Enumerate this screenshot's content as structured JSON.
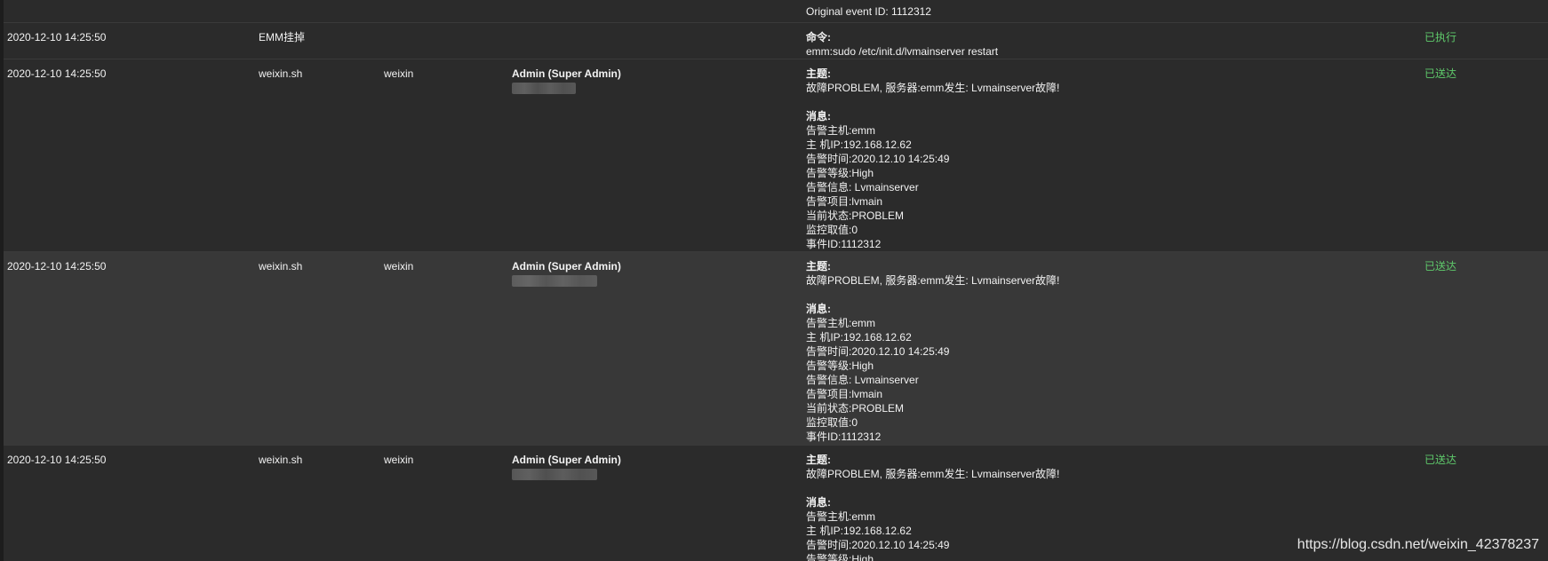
{
  "row0": {
    "msg_line": "Original event ID: 1112312"
  },
  "row1": {
    "time": "2020-12-10 14:25:50",
    "type": "EMM挂掉",
    "msg_label": "命令:",
    "msg_line": "emm:sudo /etc/init.d/lvmainserver restart",
    "status": "已执行"
  },
  "notify_rows": [
    {
      "time": "2020-12-10 14:25:50",
      "type": "weixin.sh",
      "method": "weixin",
      "recipient": "Admin (Super Admin)",
      "subject_label": "主题:",
      "subject": "故障PROBLEM, 服务器:emm发生: Lvmainserver故障!",
      "message_label": "消息:",
      "lines": [
        "告警主机:emm",
        "主 机IP:192.168.12.62",
        "告警时间:2020.12.10 14:25:49",
        "告警等级:High",
        "告警信息: Lvmainserver",
        "告警项目:lvmain",
        "当前状态:PROBLEM",
        "监控取值:0",
        "事件ID:1112312"
      ],
      "status": "已送达"
    },
    {
      "time": "2020-12-10 14:25:50",
      "type": "weixin.sh",
      "method": "weixin",
      "recipient": "Admin (Super Admin)",
      "subject_label": "主题:",
      "subject": "故障PROBLEM, 服务器:emm发生: Lvmainserver故障!",
      "message_label": "消息:",
      "lines": [
        "告警主机:emm",
        "主 机IP:192.168.12.62",
        "告警时间:2020.12.10 14:25:49",
        "告警等级:High",
        "告警信息: Lvmainserver",
        "告警项目:lvmain",
        "当前状态:PROBLEM",
        "监控取值:0",
        "事件ID:1112312"
      ],
      "status": "已送达"
    },
    {
      "time": "2020-12-10 14:25:50",
      "type": "weixin.sh",
      "method": "weixin",
      "recipient": "Admin (Super Admin)",
      "subject_label": "主题:",
      "subject": "故障PROBLEM, 服务器:emm发生: Lvmainserver故障!",
      "message_label": "消息:",
      "lines": [
        "告警主机:emm",
        "主 机IP:192.168.12.62",
        "告警时间:2020.12.10 14:25:49",
        "告警等级:High"
      ],
      "status": "已送达"
    }
  ],
  "watermark": "https://blog.csdn.net/weixin_42378237"
}
